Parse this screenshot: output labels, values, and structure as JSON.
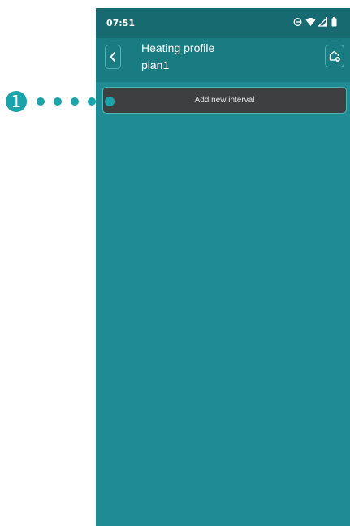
{
  "status_bar": {
    "time": "07:51",
    "icons": [
      "do-not-disturb-icon",
      "wifi-icon",
      "signal-icon",
      "battery-icon"
    ]
  },
  "app_bar": {
    "title": "Heating profile",
    "subtitle": "plan1",
    "back_icon": "chevron-left-icon",
    "home_icon": "home-add-icon"
  },
  "main": {
    "add_interval_label": "Add new interval"
  },
  "callout": {
    "number": "1"
  },
  "colors": {
    "screen_bg": "#1f8c93",
    "status_bar_bg": "#176b70",
    "app_bar_bg": "#1a7c83",
    "button_bg": "#3d3f41",
    "accent": "#1aa3ab"
  }
}
